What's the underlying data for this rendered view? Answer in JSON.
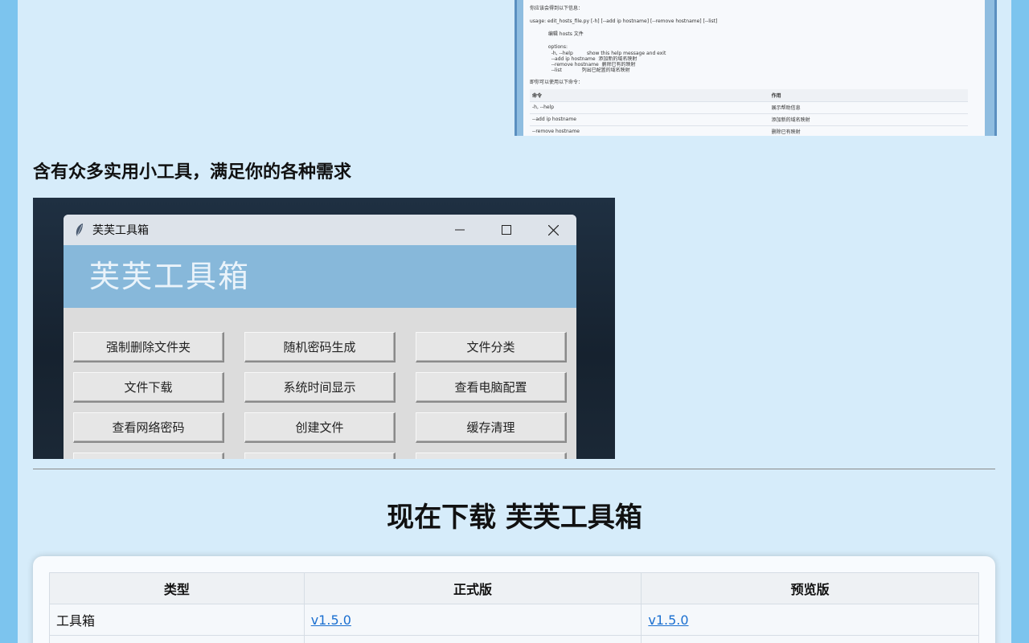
{
  "doc_screenshot": {
    "lines": [
      "你应该会得到以下信息：",
      "usage: edit_hosts_file.py [-h] [--add ip hostname] [--remove hostname] [--list]",
      "            编辑 hosts 文件",
      "            options:",
      "              -h, --help         show this help message and exit",
      "              --add ip hostname  添加新的域名映射",
      "              --remove hostname  删除已有的映射",
      "              --list             列出已配置的域名映射",
      "即你可以使用以下命令："
    ],
    "table_headers": [
      "命令",
      "作用"
    ],
    "table_rows": [
      [
        "-h, --help",
        "展示帮助信息"
      ],
      [
        "--add ip hostname",
        "添加新的域名映射"
      ],
      [
        "--remove hostname",
        "删除已有映射"
      ]
    ]
  },
  "features_heading": "含有众多实用小工具，满足你的各种需求",
  "app_window": {
    "title": "芙芙工具箱",
    "banner": "芙芙工具箱",
    "controls": {
      "minimize": "—",
      "maximize": "☐",
      "close": "✕"
    },
    "buttons": [
      "强制删除文件夹",
      "随机密码生成",
      "文件分类",
      "文件下载",
      "系统时间显示",
      "查看电脑配置",
      "查看网络密码",
      "创建文件",
      "缓存清理",
      "",
      "",
      ""
    ]
  },
  "download": {
    "heading": "现在下载 芙芙工具箱",
    "headers": [
      "类型",
      "正式版",
      "预览版"
    ],
    "rows": [
      {
        "type": "工具箱",
        "stable": "v1.5.0",
        "preview": "v1.5.0"
      },
      {
        "type": "",
        "stable": "",
        "preview": ""
      }
    ]
  },
  "colors": {
    "page_bg": "#d6ecfa",
    "outer_bg": "#7cc4ee",
    "banner": "#87b8da",
    "link": "#1a6fd0"
  }
}
